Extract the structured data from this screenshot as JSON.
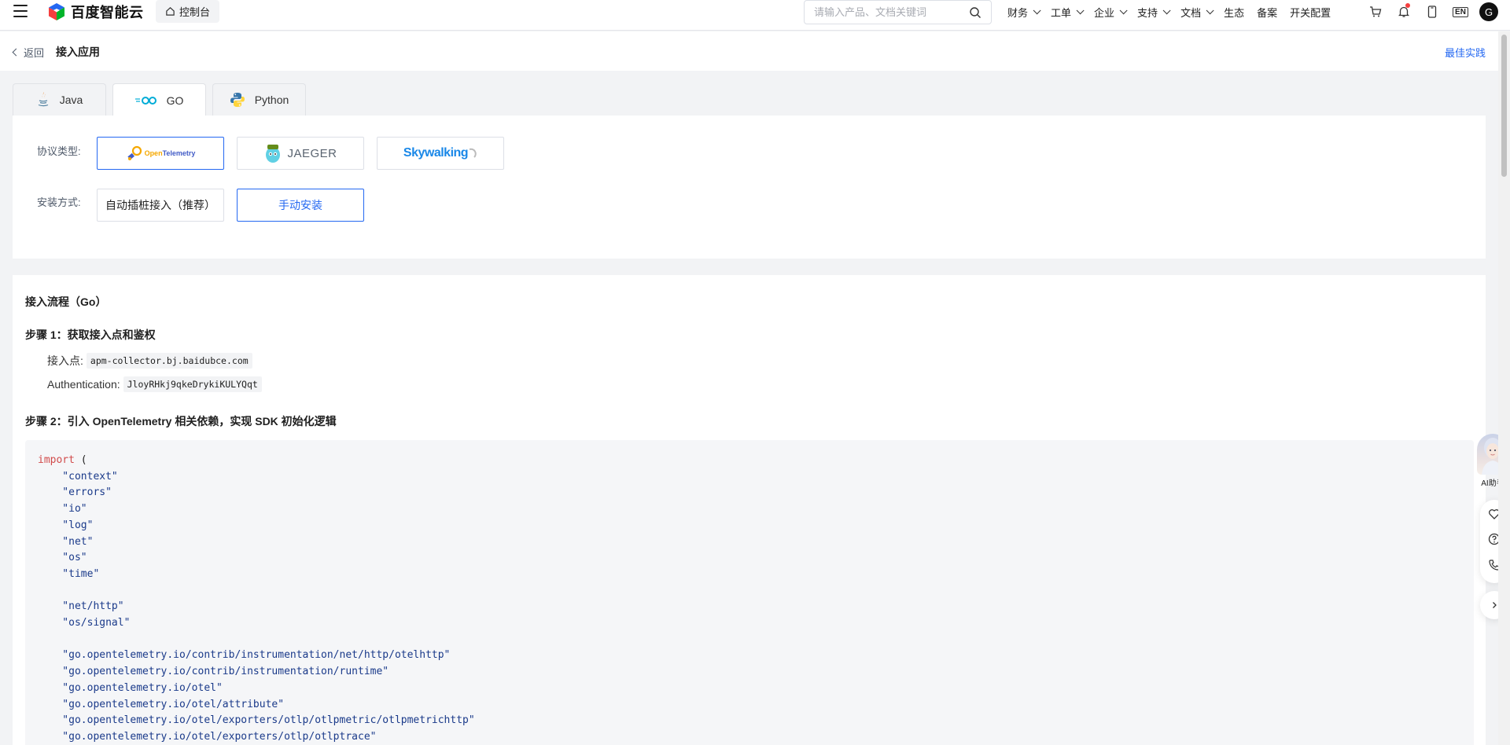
{
  "nav": {
    "logo_text": "百度智能云",
    "console_label": "控制台",
    "search_placeholder": "请输入产品、文档关键词",
    "links": [
      {
        "label": "财务",
        "dropdown": true
      },
      {
        "label": "工单",
        "dropdown": true
      },
      {
        "label": "企业",
        "dropdown": true
      },
      {
        "label": "支持",
        "dropdown": true
      },
      {
        "label": "文档",
        "dropdown": true
      },
      {
        "label": "生态",
        "dropdown": false
      },
      {
        "label": "备案",
        "dropdown": false
      },
      {
        "label": "开关配置",
        "dropdown": false
      }
    ],
    "lang": "EN",
    "avatar_initial": "G"
  },
  "subheader": {
    "back_label": "返回",
    "title": "接入应用",
    "best_practice": "最佳实践"
  },
  "tabs": [
    {
      "label": "Java",
      "icon": "java-icon",
      "active": false
    },
    {
      "label": "GO",
      "icon": "go-icon",
      "active": true
    },
    {
      "label": "Python",
      "icon": "python-icon",
      "active": false
    }
  ],
  "config": {
    "protocol_label": "协议类型:",
    "protocols": [
      {
        "name": "OpenTelemetry",
        "selected": true
      },
      {
        "name": "JAEGER",
        "selected": false
      },
      {
        "name": "Skywalking",
        "selected": false
      }
    ],
    "install_label": "安装方式:",
    "install_options": [
      {
        "label": "自动插桩接入（推荐）",
        "selected": false
      },
      {
        "label": "手动安装",
        "selected": true
      }
    ]
  },
  "content": {
    "flow_title": "接入流程（Go）",
    "step1_title": "步骤 1：获取接入点和鉴权",
    "endpoint_label": "接入点:",
    "endpoint_value": "apm-collector.bj.baidubce.com",
    "auth_label": "Authentication:",
    "auth_value": "JloyRHkj9qkeDrykiKULYQqt",
    "step2_title": "步骤 2：引入 OpenTelemetry 相关依赖，实现 SDK 初始化逻辑",
    "code_keyword": "import",
    "code_open": " (",
    "code_lines": [
      "    \"context\"",
      "    \"errors\"",
      "    \"io\"",
      "    \"log\"",
      "    \"net\"",
      "    \"os\"",
      "    \"time\"",
      "",
      "    \"net/http\"",
      "    \"os/signal\"",
      "",
      "    \"go.opentelemetry.io/contrib/instrumentation/net/http/otelhttp\"",
      "    \"go.opentelemetry.io/contrib/instrumentation/runtime\"",
      "    \"go.opentelemetry.io/otel\"",
      "    \"go.opentelemetry.io/otel/attribute\"",
      "    \"go.opentelemetry.io/otel/exporters/otlp/otlpmetric/otlpmetrichttp\"",
      "    \"go.opentelemetry.io/otel/exporters/otlp/otlptrace\""
    ]
  },
  "float": {
    "ai_label": "AI助手"
  },
  "colors": {
    "accent": "#2468f2",
    "code_keyword": "#d14b4b",
    "code_string": "#1a3a8a"
  }
}
